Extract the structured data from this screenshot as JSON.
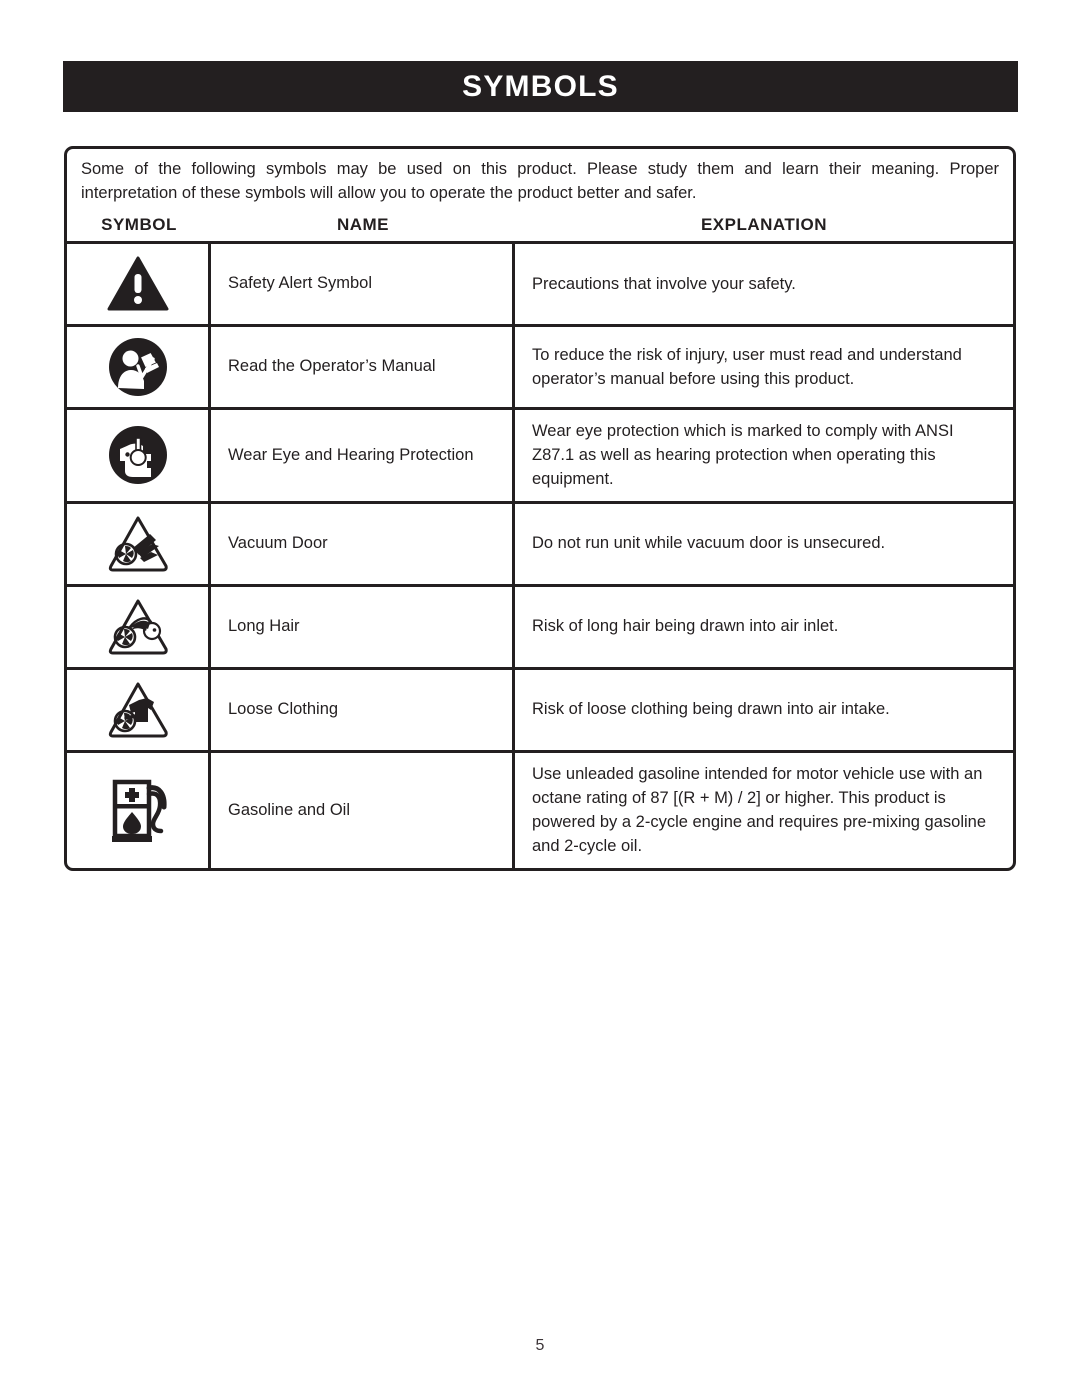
{
  "document": {
    "title": "SYMBOLS",
    "page_number": "5",
    "intro_line_1": "Some of the following symbols may be used on this product. Please study them and learn their meaning. Proper",
    "intro_line_2": "interpretation of these symbols will allow you to operate the product better and safer.",
    "colors": {
      "title_band_background": "#231f20",
      "title_text": "#ffffff",
      "table_border": "#231f20",
      "body_text": "#231f20",
      "page_background": "#ffffff"
    }
  },
  "table": {
    "headers": {
      "symbol": "SYMBOL",
      "name": "NAME",
      "explanation": "EXPLANATION"
    },
    "rows": [
      {
        "icon": "safety-alert-triangle-icon",
        "name": "Safety Alert Symbol",
        "explanation": "Precautions that involve your safety."
      },
      {
        "icon": "read-operators-manual-icon",
        "name": "Read the Operator’s Manual",
        "explanation": "To reduce the risk of injury, user must read and understand operator’s manual before using this product."
      },
      {
        "icon": "wear-eye-and-hearing-protection-icon",
        "name": "Wear Eye and Hearing Protection",
        "explanation": "Wear eye protection which is marked to comply with ANSI Z87.1 as well as hearing protection when operating this equipment."
      },
      {
        "icon": "vacuum-door-warning-icon",
        "name": "Vacuum Door",
        "explanation": "Do not run unit while vacuum door is unsecured."
      },
      {
        "icon": "long-hair-warning-icon",
        "name": "Long Hair",
        "explanation": "Risk of long hair being drawn into air inlet."
      },
      {
        "icon": "loose-clothing-warning-icon",
        "name": "Loose Clothing",
        "explanation": "Risk of loose clothing being drawn into air intake."
      },
      {
        "icon": "gasoline-and-oil-pump-icon",
        "name": "Gasoline and Oil",
        "explanation": "Use unleaded gasoline intended for motor vehicle use with an octane rating of 87 [(R + M) / 2] or higher. This product is powered by a 2-cycle engine and requires pre-mixing gasoline and 2-cycle oil."
      }
    ]
  }
}
